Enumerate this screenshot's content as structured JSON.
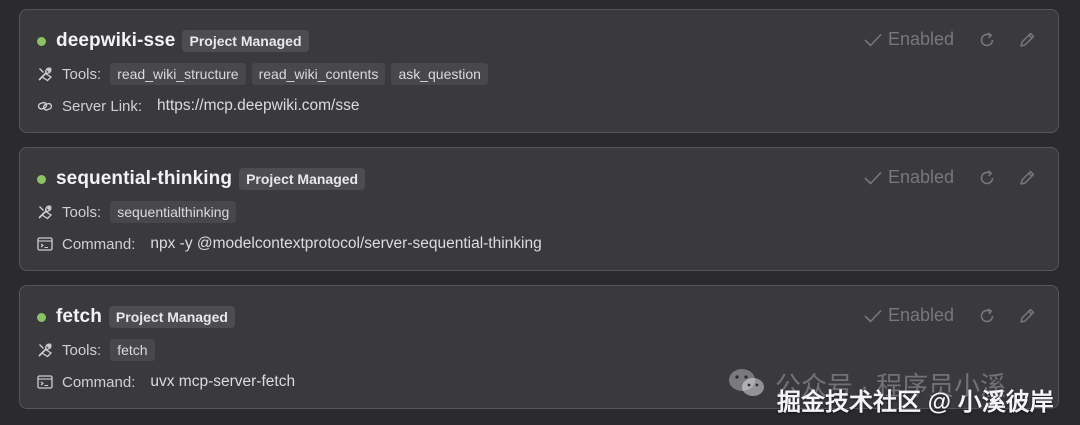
{
  "colors": {
    "status_enabled": "#8cc265",
    "card_bg": "#3a3a3d",
    "page_bg": "#2b2b2e"
  },
  "servers": [
    {
      "name": "deepwiki-sse",
      "badge": "Project Managed",
      "status": "Enabled",
      "tools_label": "Tools:",
      "tools": [
        "read_wiki_structure",
        "read_wiki_contents",
        "ask_question"
      ],
      "info_label": "Server Link:",
      "info_value": "https://mcp.deepwiki.com/sse",
      "info_icon": "link-icon"
    },
    {
      "name": "sequential-thinking",
      "badge": "Project Managed",
      "status": "Enabled",
      "tools_label": "Tools:",
      "tools": [
        "sequentialthinking"
      ],
      "info_label": "Command:",
      "info_value": "npx -y @modelcontextprotocol/server-sequential-thinking",
      "info_icon": "terminal-icon"
    },
    {
      "name": "fetch",
      "badge": "Project Managed",
      "status": "Enabled",
      "tools_label": "Tools:",
      "tools": [
        "fetch"
      ],
      "info_label": "Command:",
      "info_value": "uvx mcp-server-fetch",
      "info_icon": "terminal-icon"
    }
  ],
  "watermark": {
    "line1": "公众号 · 程序员小溪",
    "line2": "掘金技术社区 @ 小溪彼岸"
  }
}
